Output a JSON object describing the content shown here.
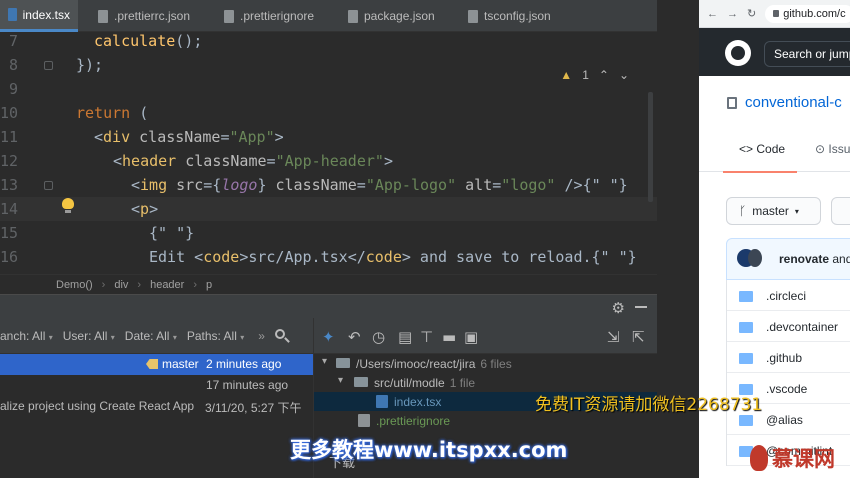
{
  "editor": {
    "tabs": [
      {
        "label": "index.tsx",
        "active": true
      },
      {
        "label": ".prettierrc.json"
      },
      {
        "label": ".prettierignore"
      },
      {
        "label": "package.json"
      },
      {
        "label": "tsconfig.json"
      }
    ],
    "line_numbers": [
      "7",
      "8",
      "9",
      "10",
      "11",
      "12",
      "13",
      "14",
      "15",
      "16"
    ],
    "warning_count": "1",
    "code": {
      "l7_fn": "calculate",
      "l7_rest": "();",
      "l8": "});",
      "l10_kw": "return",
      "l10_rest": " (",
      "l11_tag": "div",
      "l11_attr": "className",
      "l11_val": "\"App\"",
      "l12_tag": "header",
      "l12_attr": "className",
      "l12_val": "\"App-header\"",
      "l13_tag": "img",
      "l13_attr1": "src",
      "l13_expr": "logo",
      "l13_attr2": "className",
      "l13_val2": "\"App-logo\"",
      "l13_attr3": "alt",
      "l13_val3": "\"logo\"",
      "l13_tail": "{\" \"}",
      "l14_tag": "p",
      "l15": "{\" \"}",
      "l16_text1": "Edit ",
      "l16_tag": "code",
      "l16_inner": "src/App.tsx",
      "l16_text2": " and save to reload.",
      "l16_tail": "{\" \"}"
    },
    "breadcrumb": [
      "Demo()",
      "div",
      "header",
      "p"
    ]
  },
  "vcs": {
    "filters": [
      "anch: All",
      "User: All",
      "Date: All",
      "Paths: All"
    ],
    "commits": [
      {
        "branch": "master",
        "time": "2 minutes ago",
        "selected": true
      },
      {
        "time": "17 minutes ago"
      },
      {
        "message": "alize project using Create React App",
        "time": "3/11/20, 5:27 下午"
      }
    ],
    "tree": [
      {
        "label": "/Users/imooc/react/jira",
        "count": "6 files"
      },
      {
        "label": "src/util/modle",
        "count": "1 file"
      },
      {
        "label": "index.tsx"
      },
      {
        "label": ".prettierignore"
      }
    ]
  },
  "browser": {
    "url": "github.com/c",
    "search_placeholder": "Search or jump",
    "repo_name": "conventional-c",
    "tab_code": "Code",
    "tab_issues": "Issu",
    "branch": "master",
    "commit_author": "renovate",
    "commit_rest": " and",
    "files": [
      ".circleci",
      ".devcontainer",
      ".github",
      ".vscode",
      "@alias",
      "@commitlint"
    ]
  },
  "overlay": {
    "wechat_note": "免费IT资源请加微信2268731",
    "site_banner": "更多教程www.itspxx.com",
    "bottom_caption": "下载",
    "logo_text": "慕课网"
  },
  "colors": {
    "editor_bg": "#2b2b2b",
    "keyword": "#cc7832",
    "tag": "#e8bf6a",
    "string": "#6a8759",
    "selection": "#2f65ca",
    "github_link": "#0366d6"
  }
}
